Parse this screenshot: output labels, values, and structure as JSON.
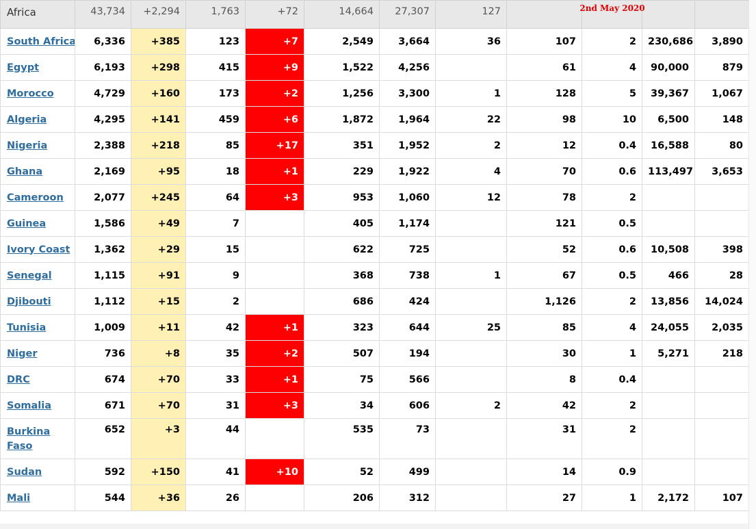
{
  "stamp": "2nd May 2020",
  "colors": {
    "link": "#2f6d9e",
    "new_cases_bg": "#fff0b3",
    "new_deaths_bg": "#ff0000",
    "stamp": "#e00000"
  },
  "columns": [
    "country",
    "total_cases",
    "new_cases",
    "total_deaths",
    "new_deaths",
    "total_recovered",
    "active_cases",
    "serious_critical",
    "cases_per_1m",
    "deaths_per_1m",
    "total_tests",
    "tests_per_1m"
  ],
  "total_row": {
    "country": "Africa",
    "total_cases": "43,734",
    "new_cases": "+2,294",
    "total_deaths": "1,763",
    "new_deaths": "+72",
    "total_recovered": "14,664",
    "active_cases": "27,307",
    "serious_critical": "127",
    "cases_per_1m": "",
    "deaths_per_1m": "",
    "total_tests": "",
    "tests_per_1m": ""
  },
  "rows": [
    {
      "country": "South Africa",
      "total_cases": "6,336",
      "new_cases": "+385",
      "total_deaths": "123",
      "new_deaths": "+7",
      "total_recovered": "2,549",
      "active_cases": "3,664",
      "serious_critical": "36",
      "cases_per_1m": "107",
      "deaths_per_1m": "2",
      "total_tests": "230,686",
      "tests_per_1m": "3,890"
    },
    {
      "country": "Egypt",
      "total_cases": "6,193",
      "new_cases": "+298",
      "total_deaths": "415",
      "new_deaths": "+9",
      "total_recovered": "1,522",
      "active_cases": "4,256",
      "serious_critical": "",
      "cases_per_1m": "61",
      "deaths_per_1m": "4",
      "total_tests": "90,000",
      "tests_per_1m": "879"
    },
    {
      "country": "Morocco",
      "total_cases": "4,729",
      "new_cases": "+160",
      "total_deaths": "173",
      "new_deaths": "+2",
      "total_recovered": "1,256",
      "active_cases": "3,300",
      "serious_critical": "1",
      "cases_per_1m": "128",
      "deaths_per_1m": "5",
      "total_tests": "39,367",
      "tests_per_1m": "1,067"
    },
    {
      "country": "Algeria",
      "total_cases": "4,295",
      "new_cases": "+141",
      "total_deaths": "459",
      "new_deaths": "+6",
      "total_recovered": "1,872",
      "active_cases": "1,964",
      "serious_critical": "22",
      "cases_per_1m": "98",
      "deaths_per_1m": "10",
      "total_tests": "6,500",
      "tests_per_1m": "148"
    },
    {
      "country": "Nigeria",
      "total_cases": "2,388",
      "new_cases": "+218",
      "total_deaths": "85",
      "new_deaths": "+17",
      "total_recovered": "351",
      "active_cases": "1,952",
      "serious_critical": "2",
      "cases_per_1m": "12",
      "deaths_per_1m": "0.4",
      "total_tests": "16,588",
      "tests_per_1m": "80"
    },
    {
      "country": "Ghana",
      "total_cases": "2,169",
      "new_cases": "+95",
      "total_deaths": "18",
      "new_deaths": "+1",
      "total_recovered": "229",
      "active_cases": "1,922",
      "serious_critical": "4",
      "cases_per_1m": "70",
      "deaths_per_1m": "0.6",
      "total_tests": "113,497",
      "tests_per_1m": "3,653"
    },
    {
      "country": "Cameroon",
      "total_cases": "2,077",
      "new_cases": "+245",
      "total_deaths": "64",
      "new_deaths": "+3",
      "total_recovered": "953",
      "active_cases": "1,060",
      "serious_critical": "12",
      "cases_per_1m": "78",
      "deaths_per_1m": "2",
      "total_tests": "",
      "tests_per_1m": ""
    },
    {
      "country": "Guinea",
      "total_cases": "1,586",
      "new_cases": "+49",
      "total_deaths": "7",
      "new_deaths": "",
      "total_recovered": "405",
      "active_cases": "1,174",
      "serious_critical": "",
      "cases_per_1m": "121",
      "deaths_per_1m": "0.5",
      "total_tests": "",
      "tests_per_1m": ""
    },
    {
      "country": "Ivory Coast",
      "total_cases": "1,362",
      "new_cases": "+29",
      "total_deaths": "15",
      "new_deaths": "",
      "total_recovered": "622",
      "active_cases": "725",
      "serious_critical": "",
      "cases_per_1m": "52",
      "deaths_per_1m": "0.6",
      "total_tests": "10,508",
      "tests_per_1m": "398"
    },
    {
      "country": "Senegal",
      "total_cases": "1,115",
      "new_cases": "+91",
      "total_deaths": "9",
      "new_deaths": "",
      "total_recovered": "368",
      "active_cases": "738",
      "serious_critical": "1",
      "cases_per_1m": "67",
      "deaths_per_1m": "0.5",
      "total_tests": "466",
      "tests_per_1m": "28"
    },
    {
      "country": "Djibouti",
      "total_cases": "1,112",
      "new_cases": "+15",
      "total_deaths": "2",
      "new_deaths": "",
      "total_recovered": "686",
      "active_cases": "424",
      "serious_critical": "",
      "cases_per_1m": "1,126",
      "deaths_per_1m": "2",
      "total_tests": "13,856",
      "tests_per_1m": "14,024"
    },
    {
      "country": "Tunisia",
      "total_cases": "1,009",
      "new_cases": "+11",
      "total_deaths": "42",
      "new_deaths": "+1",
      "total_recovered": "323",
      "active_cases": "644",
      "serious_critical": "25",
      "cases_per_1m": "85",
      "deaths_per_1m": "4",
      "total_tests": "24,055",
      "tests_per_1m": "2,035"
    },
    {
      "country": "Niger",
      "total_cases": "736",
      "new_cases": "+8",
      "total_deaths": "35",
      "new_deaths": "+2",
      "total_recovered": "507",
      "active_cases": "194",
      "serious_critical": "",
      "cases_per_1m": "30",
      "deaths_per_1m": "1",
      "total_tests": "5,271",
      "tests_per_1m": "218"
    },
    {
      "country": "DRC",
      "total_cases": "674",
      "new_cases": "+70",
      "total_deaths": "33",
      "new_deaths": "+1",
      "total_recovered": "75",
      "active_cases": "566",
      "serious_critical": "",
      "cases_per_1m": "8",
      "deaths_per_1m": "0.4",
      "total_tests": "",
      "tests_per_1m": ""
    },
    {
      "country": "Somalia",
      "total_cases": "671",
      "new_cases": "+70",
      "total_deaths": "31",
      "new_deaths": "+3",
      "total_recovered": "34",
      "active_cases": "606",
      "serious_critical": "2",
      "cases_per_1m": "42",
      "deaths_per_1m": "2",
      "total_tests": "",
      "tests_per_1m": ""
    },
    {
      "country": "Burkina Faso",
      "total_cases": "652",
      "new_cases": "+3",
      "total_deaths": "44",
      "new_deaths": "",
      "total_recovered": "535",
      "active_cases": "73",
      "serious_critical": "",
      "cases_per_1m": "31",
      "deaths_per_1m": "2",
      "total_tests": "",
      "tests_per_1m": ""
    },
    {
      "country": "Sudan",
      "total_cases": "592",
      "new_cases": "+150",
      "total_deaths": "41",
      "new_deaths": "+10",
      "total_recovered": "52",
      "active_cases": "499",
      "serious_critical": "",
      "cases_per_1m": "14",
      "deaths_per_1m": "0.9",
      "total_tests": "",
      "tests_per_1m": ""
    },
    {
      "country": "Mali",
      "total_cases": "544",
      "new_cases": "+36",
      "total_deaths": "26",
      "new_deaths": "",
      "total_recovered": "206",
      "active_cases": "312",
      "serious_critical": "",
      "cases_per_1m": "27",
      "deaths_per_1m": "1",
      "total_tests": "2,172",
      "tests_per_1m": "107"
    }
  ]
}
